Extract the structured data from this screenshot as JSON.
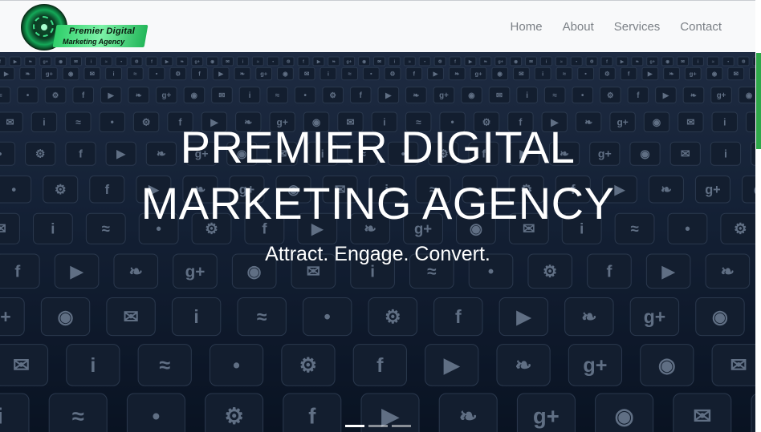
{
  "brand": {
    "line1": "Premier Digital",
    "line2": "Marketing Agency",
    "accent_color": "#2fcf6a"
  },
  "nav": {
    "items": [
      {
        "label": "Home"
      },
      {
        "label": "About"
      },
      {
        "label": "Services"
      },
      {
        "label": "Contact"
      }
    ]
  },
  "hero": {
    "title_line1": "PREMIER DIGITAL",
    "title_line2": "MARKETING AGENCY",
    "tagline": "Attract. Engage. Convert.",
    "background_icons": [
      "facebook-icon",
      "youtube-icon",
      "twitter-icon",
      "google-plus-icon",
      "camera-icon",
      "mail-icon",
      "info-icon",
      "wifi-icon",
      "microphone-icon",
      "gear-icon"
    ]
  },
  "carousel": {
    "slide_count": 3,
    "active_index": 0
  },
  "colors": {
    "scrollbar_thumb": "#2fa84a",
    "nav_text": "#7b8086"
  }
}
